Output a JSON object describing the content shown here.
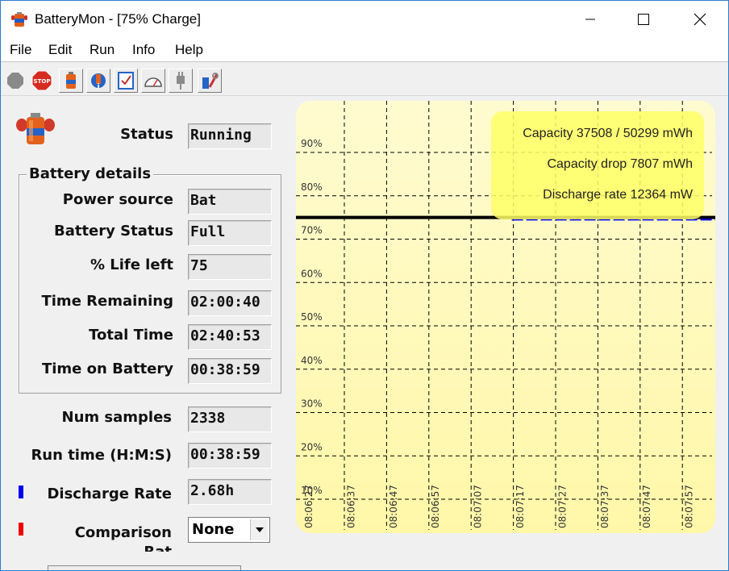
{
  "window": {
    "title": "BatteryMon - [75% Charge]",
    "controls": {
      "minimize": "minimize",
      "maximize": "maximize",
      "close": "close"
    }
  },
  "menu": [
    "File",
    "Edit",
    "Run",
    "Info",
    "Help"
  ],
  "toolbar": {
    "buttons": [
      {
        "name": "record-icon",
        "color": "#8a8a8a"
      },
      {
        "name": "stop-icon",
        "color": "#d62b1f"
      },
      {
        "name": "battery-icon",
        "color": "#e2611c"
      },
      {
        "name": "battery-info-icon",
        "color": "#2463c7"
      },
      {
        "name": "checklist-icon",
        "color": "#2463c7"
      },
      {
        "name": "gauge-icon",
        "color": "#7a7a7a"
      },
      {
        "name": "plug-icon",
        "color": "#8a8a8a"
      },
      {
        "name": "tools-icon",
        "color": "#c83030"
      }
    ]
  },
  "status": {
    "label": "Status",
    "value": "Running"
  },
  "battery_details": {
    "legend": "Battery details",
    "fields": [
      {
        "label": "Power source",
        "value": "Bat"
      },
      {
        "label": "Battery Status",
        "value": "Full"
      },
      {
        "label": "% Life left",
        "value": "75"
      },
      {
        "label": "Time Remaining",
        "value": "02:00:40"
      },
      {
        "label": "Total Time",
        "value": "02:40:53"
      },
      {
        "label": "Time on Battery",
        "value": "00:38:59"
      }
    ]
  },
  "stats": {
    "num_samples": {
      "label": "Num samples",
      "value": "2338"
    },
    "run_time": {
      "label": "Run time (H:M:S)",
      "value": "00:38:59"
    },
    "discharge_rate": {
      "label": "Discharge Rate",
      "value": "2.68h",
      "marker_color": "#0000ee"
    },
    "comparison": {
      "label": "Comparison",
      "label_second_line": "Rat",
      "selected": "None",
      "marker_color": "#ee0000"
    }
  },
  "chart_data": {
    "type": "line",
    "y_ticks": [
      "90%",
      "80%",
      "70%",
      "60%",
      "50%",
      "40%",
      "30%",
      "20%",
      "10%"
    ],
    "y_tick_values": [
      90,
      80,
      70,
      60,
      50,
      40,
      30,
      20,
      10
    ],
    "x_ticks": [
      "08:06:27",
      "08:06:37",
      "08:06:47",
      "08:06:57",
      "08:07:07",
      "08:07:17",
      "08:07:27",
      "08:07:37",
      "08:07:47",
      "08:07:57"
    ],
    "grid": true,
    "ylim": [
      0,
      100
    ],
    "series": [
      {
        "color": "#000000",
        "values": [
          75,
          75,
          75,
          75,
          75,
          75,
          75,
          75,
          75,
          75
        ]
      },
      {
        "color": "#0000ee",
        "values": [
          null,
          null,
          null,
          null,
          74.5,
          74.5,
          74.5,
          74.5,
          74.5,
          74.5
        ]
      }
    ],
    "info": [
      "Capacity 37508 / 50299 mWh",
      "Capacity drop 7807 mWh",
      "Discharge rate 12364 mW"
    ],
    "colors": {
      "background_top": "#fffbd0",
      "background_bottom": "#fff7a8",
      "info_box": "#ffff66"
    }
  }
}
